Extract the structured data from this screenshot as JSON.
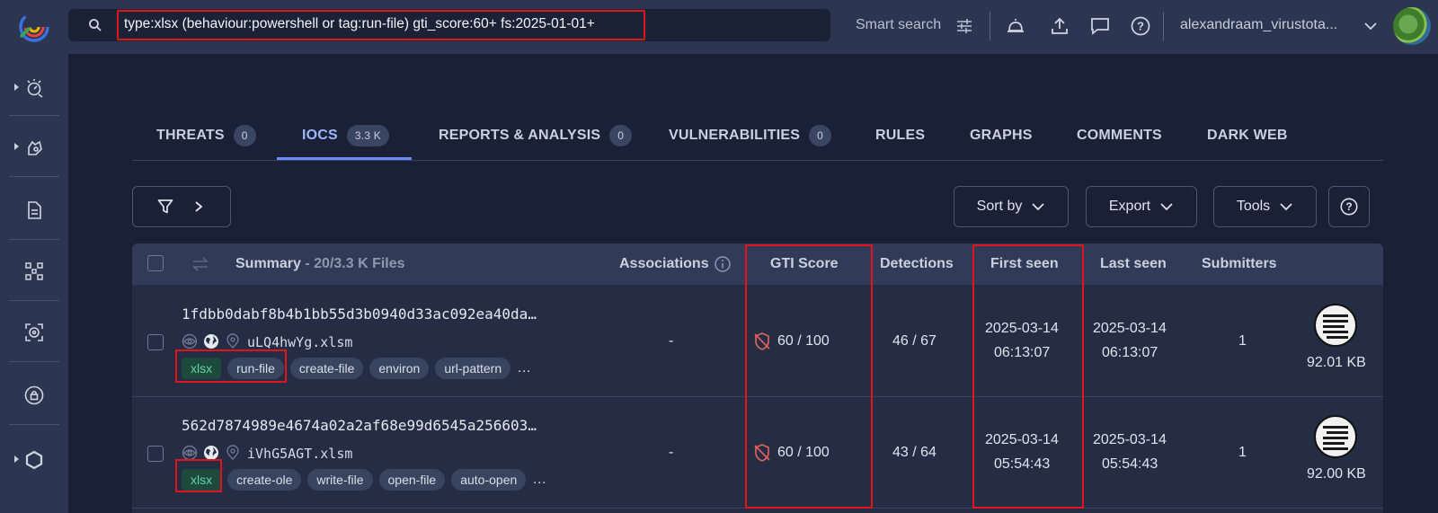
{
  "search": {
    "query": "type:xlsx (behaviour:powershell or tag:run-file) gti_score:60+ fs:2025-01-01+",
    "smart_search_label": "Smart search"
  },
  "user": {
    "name": "alexandraam_virustota..."
  },
  "tabs": [
    {
      "label": "THREATS",
      "count": "0"
    },
    {
      "label": "IOCS",
      "count": "3.3 K",
      "active": true
    },
    {
      "label": "REPORTS & ANALYSIS",
      "count": "0"
    },
    {
      "label": "VULNERABILITIES",
      "count": "0"
    },
    {
      "label": "RULES"
    },
    {
      "label": "GRAPHS"
    },
    {
      "label": "COMMENTS"
    },
    {
      "label": "DARK WEB"
    }
  ],
  "toolbar": {
    "sort_label": "Sort by",
    "export_label": "Export",
    "tools_label": "Tools"
  },
  "table": {
    "headers": {
      "summary": "Summary",
      "summary_count": "- 20/3.3 K Files",
      "associations": "Associations",
      "gti_score": "GTI Score",
      "detections": "Detections",
      "first_seen": "First seen",
      "last_seen": "Last seen",
      "submitters": "Submitters"
    },
    "rows": [
      {
        "hash": "1fdbb0dabf8b4b1bb55d3b0940d33ac092ea40da…",
        "file_name": "uLQ4hwYg.xlsm",
        "tags": [
          "xlsx",
          "run-file",
          "create-file",
          "environ",
          "url-pattern"
        ],
        "more": "…",
        "associations": "-",
        "gti_score": "60 / 100",
        "detections": "46 / 67",
        "first_seen_date": "2025-03-14",
        "first_seen_time": "06:13:07",
        "last_seen_date": "2025-03-14",
        "last_seen_time": "06:13:07",
        "submitters": "1",
        "size": "92.01 KB"
      },
      {
        "hash": "562d7874989e4674a02a2af68e99d6545a256603…",
        "file_name": "iVhG5AGT.xlsm",
        "tags": [
          "xlsx",
          "create-ole",
          "write-file",
          "open-file",
          "auto-open"
        ],
        "more": "…",
        "associations": "-",
        "gti_score": "60 / 100",
        "detections": "43 / 64",
        "first_seen_date": "2025-03-14",
        "first_seen_time": "05:54:43",
        "last_seen_date": "2025-03-14",
        "last_seen_time": "05:54:43",
        "submitters": "1",
        "size": "92.00 KB"
      }
    ]
  },
  "colors": {
    "accent": "#6f8cff",
    "highlight_box": "#e0141a",
    "type_tag": "#5fd6a6"
  }
}
